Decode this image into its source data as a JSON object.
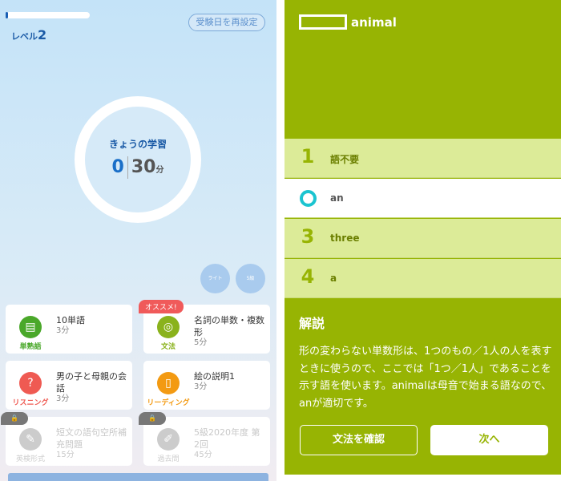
{
  "home": {
    "progress_percent": 3,
    "level_label": "レベル",
    "level_value": "2",
    "reset_button": "受験日を再設定",
    "today_title": "きょうの学習",
    "done_minutes": "0",
    "goal_minutes": "30",
    "minutes_unit": "分",
    "mode_buttons": [
      "ライト",
      "5級"
    ],
    "cards": [
      {
        "category": "単熟語",
        "title": "10単語",
        "minutes": "3分",
        "color": "#4aa82a",
        "icon": "vocab-card-icon",
        "locked": false
      },
      {
        "category": "文法",
        "title": "名詞の単数・複数形",
        "minutes": "5分",
        "color": "#8ab21c",
        "icon": "grammar-icon",
        "locked": false,
        "badge": "オススメ!"
      },
      {
        "category": "リスニング",
        "title": "男の子と母親の会話",
        "minutes": "3分",
        "color": "#ef5a52",
        "icon": "ear-icon",
        "locked": false
      },
      {
        "category": "リーディング",
        "title": "絵の説明1",
        "minutes": "3分",
        "color": "#f39a12",
        "icon": "book-icon",
        "locked": false
      },
      {
        "category": "英検形式",
        "title": "短文の語句空所補充問題",
        "minutes": "15分",
        "color": "#cccccc",
        "icon": "pencil-icon",
        "locked": true
      },
      {
        "category": "過去問",
        "title": "5級2020年度 第2回",
        "minutes": "45分",
        "color": "#cccccc",
        "icon": "exam-sheet-icon",
        "locked": true
      }
    ]
  },
  "quiz": {
    "question_word": "animal",
    "options": [
      {
        "number": "1",
        "text": "語不要",
        "selected": false
      },
      {
        "number": "2",
        "text": "an",
        "selected": true
      },
      {
        "number": "3",
        "text": "three",
        "selected": false
      },
      {
        "number": "4",
        "text": "a",
        "selected": false
      }
    ],
    "explanation_title": "解説",
    "explanation": "形の変わらない単数形は、1つのもの／1人の人を表すときに使うので、ここでは「1つ／1人」であることを示す語を使います。animalは母音で始まる語なので、anが適切です。",
    "grammar_button": "文法を確認",
    "next_button": "次へ",
    "colors": {
      "accent": "#97b403",
      "option_bg": "#dceb98",
      "correct_mark": "#1bc4d0"
    }
  }
}
